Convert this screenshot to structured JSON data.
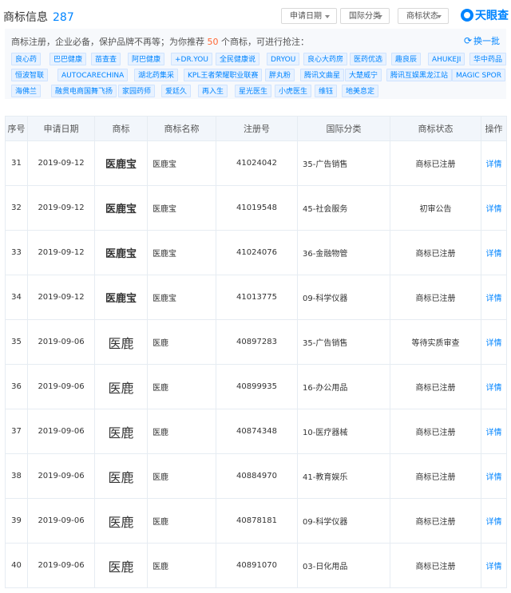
{
  "header": {
    "title": "商标信息",
    "count": "287",
    "filters": [
      {
        "label": "申请日期"
      },
      {
        "label": "国际分类"
      },
      {
        "label": "商标状态"
      }
    ],
    "logo_text": "天眼查"
  },
  "recommend": {
    "text_prefix": "商标注册，企业必备，保护品牌不再等；为你推荐",
    "count": "50",
    "text_suffix": "个商标，可进行抢注：",
    "refresh_label": "换一批",
    "tags": [
      "良心药",
      "巴巴健康",
      "苗查查",
      "阿巴健康",
      "+DR.YOU",
      "全民健康说",
      "DRYOU",
      "良心大药房",
      "医药优选",
      "趣良辰",
      "AHUKEJI",
      "华中药品",
      "恒波智联",
      "AUTOCARECHINA",
      "湖北药集采",
      "KPL王者荣耀职业联赛",
      "胖丸粉",
      "腾讯文曲星",
      "大楚威宁",
      "腾讯互娱黑龙江站",
      "MAGIC SPOR",
      "海佛兰",
      "融贯电商国舞飞扬",
      "家园药师",
      "爱廷久",
      "再入生",
      "星光医生",
      "小虎医生",
      "维钰",
      "地美息定"
    ]
  },
  "table": {
    "headers": [
      "序号",
      "申请日期",
      "商标",
      "商标名称",
      "注册号",
      "国际分类",
      "商标状态",
      "操作"
    ],
    "rows": [
      {
        "no": "31",
        "date": "2019-09-12",
        "mark": "医鹿宝",
        "name": "医鹿宝",
        "reg": "41024042",
        "cls": "35-广告销售",
        "status": "商标已注册",
        "action": "详情"
      },
      {
        "no": "32",
        "date": "2019-09-12",
        "mark": "医鹿宝",
        "name": "医鹿宝",
        "reg": "41019548",
        "cls": "45-社会服务",
        "status": "初审公告",
        "action": "详情"
      },
      {
        "no": "33",
        "date": "2019-09-12",
        "mark": "医鹿宝",
        "name": "医鹿宝",
        "reg": "41024076",
        "cls": "36-金融物管",
        "status": "商标已注册",
        "action": "详情"
      },
      {
        "no": "34",
        "date": "2019-09-12",
        "mark": "医鹿宝",
        "name": "医鹿宝",
        "reg": "41013775",
        "cls": "09-科学仪器",
        "status": "商标已注册",
        "action": "详情"
      },
      {
        "no": "35",
        "date": "2019-09-06",
        "mark": "医鹿",
        "name": "医鹿",
        "reg": "40897283",
        "cls": "35-广告销售",
        "status": "等待实质审查",
        "action": "详情"
      },
      {
        "no": "36",
        "date": "2019-09-06",
        "mark": "医鹿",
        "name": "医鹿",
        "reg": "40899935",
        "cls": "16-办公用品",
        "status": "商标已注册",
        "action": "详情"
      },
      {
        "no": "37",
        "date": "2019-09-06",
        "mark": "医鹿",
        "name": "医鹿",
        "reg": "40874348",
        "cls": "10-医疗器械",
        "status": "商标已注册",
        "action": "详情"
      },
      {
        "no": "38",
        "date": "2019-09-06",
        "mark": "医鹿",
        "name": "医鹿",
        "reg": "40884970",
        "cls": "41-教育娱乐",
        "status": "商标已注册",
        "action": "详情"
      },
      {
        "no": "39",
        "date": "2019-09-06",
        "mark": "医鹿",
        "name": "医鹿",
        "reg": "40878181",
        "cls": "09-科学仪器",
        "status": "商标已注册",
        "action": "详情"
      },
      {
        "no": "40",
        "date": "2019-09-06",
        "mark": "医鹿",
        "name": "医鹿",
        "reg": "40891070",
        "cls": "03-日化用品",
        "status": "商标已注册",
        "action": "详情"
      }
    ]
  },
  "colors": {
    "accent": "#0084ff",
    "highlight": "#ff6633",
    "header_bg": "#f2f6fb",
    "tag_bg": "#e8f2ff"
  }
}
